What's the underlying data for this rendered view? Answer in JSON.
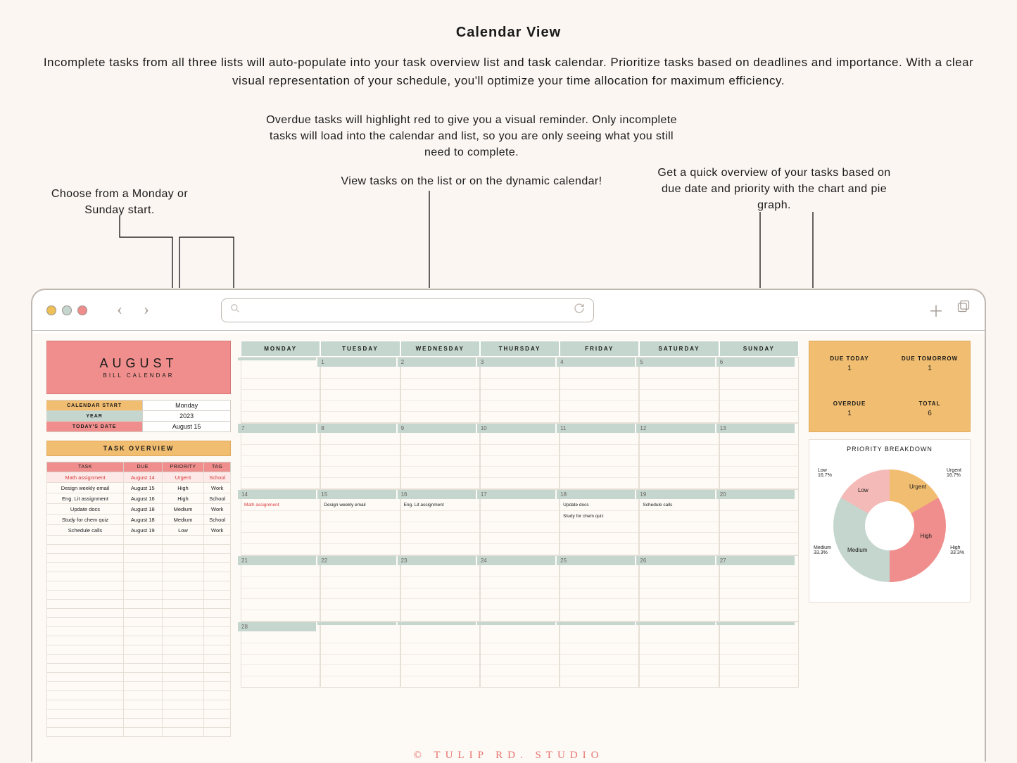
{
  "header": {
    "title": "Calendar View",
    "description": "Incomplete tasks from all three lists will auto-populate into your task overview list and task calendar. Prioritize tasks based on deadlines and importance. With a clear visual representation of your schedule, you'll optimize your time allocation for maximum efficiency."
  },
  "callouts": {
    "left": "Choose from a Monday or Sunday start.",
    "center1": "Overdue tasks will highlight red to give you a visual reminder. Only incomplete tasks will load into the calendar and list, so you are only seeing what you still need to complete.",
    "center2": "View tasks on the list or on the dynamic calendar!",
    "right": "Get a quick overview of your tasks based on due date and priority with the chart and pie graph."
  },
  "month": {
    "name": "AUGUST",
    "subtitle": "BILL CALENDAR"
  },
  "settings": {
    "calendar_start_label": "CALENDAR START",
    "calendar_start_value": "Monday",
    "year_label": "YEAR",
    "year_value": "2023",
    "today_label": "TODAY'S DATE",
    "today_value": "August 15"
  },
  "task_overview": {
    "title": "TASK OVERVIEW",
    "headers": {
      "task": "TASK",
      "due": "DUE",
      "priority": "PRIORITY",
      "tag": "TAG"
    },
    "rows": [
      {
        "task": "Math assignment",
        "due": "August 14",
        "priority": "Urgent",
        "tag": "School",
        "overdue": true
      },
      {
        "task": "Design weekly email",
        "due": "August 15",
        "priority": "High",
        "tag": "Work",
        "overdue": false
      },
      {
        "task": "Eng. Lit assignment",
        "due": "August 16",
        "priority": "High",
        "tag": "School",
        "overdue": false
      },
      {
        "task": "Update docs",
        "due": "August 18",
        "priority": "Medium",
        "tag": "Work",
        "overdue": false
      },
      {
        "task": "Study for chem quiz",
        "due": "August 18",
        "priority": "Medium",
        "tag": "School",
        "overdue": false
      },
      {
        "task": "Schedule calls",
        "due": "August 19",
        "priority": "Low",
        "tag": "Work",
        "overdue": false
      }
    ]
  },
  "calendar": {
    "days": [
      "MONDAY",
      "TUESDAY",
      "WEDNESDAY",
      "THURSDAY",
      "FRIDAY",
      "SATURDAY",
      "SUNDAY"
    ],
    "weeks": [
      [
        {
          "n": "",
          "t": []
        },
        {
          "n": "1",
          "t": []
        },
        {
          "n": "2",
          "t": []
        },
        {
          "n": "3",
          "t": []
        },
        {
          "n": "4",
          "t": []
        },
        {
          "n": "5",
          "t": []
        },
        {
          "n": "6",
          "t": []
        }
      ],
      [
        {
          "n": "7",
          "t": []
        },
        {
          "n": "8",
          "t": []
        },
        {
          "n": "9",
          "t": []
        },
        {
          "n": "10",
          "t": []
        },
        {
          "n": "11",
          "t": []
        },
        {
          "n": "12",
          "t": []
        },
        {
          "n": "13",
          "t": []
        }
      ],
      [
        {
          "n": "14",
          "t": [
            {
              "txt": "Math assignment",
              "red": true
            }
          ]
        },
        {
          "n": "15",
          "t": [
            {
              "txt": "Design weekly email"
            }
          ]
        },
        {
          "n": "16",
          "t": [
            {
              "txt": "Eng. Lit assignment"
            }
          ]
        },
        {
          "n": "17",
          "t": []
        },
        {
          "n": "18",
          "t": [
            {
              "txt": "Update docs"
            },
            {
              "txt": "Study for chem quiz"
            }
          ]
        },
        {
          "n": "19",
          "t": [
            {
              "txt": "Schedule calls"
            }
          ]
        },
        {
          "n": "20",
          "t": []
        }
      ],
      [
        {
          "n": "21",
          "t": []
        },
        {
          "n": "22",
          "t": []
        },
        {
          "n": "23",
          "t": []
        },
        {
          "n": "24",
          "t": []
        },
        {
          "n": "25",
          "t": []
        },
        {
          "n": "26",
          "t": []
        },
        {
          "n": "27",
          "t": []
        }
      ],
      [
        {
          "n": "28",
          "t": []
        },
        {
          "n": "",
          "t": []
        },
        {
          "n": "",
          "t": []
        },
        {
          "n": "",
          "t": []
        },
        {
          "n": "",
          "t": []
        },
        {
          "n": "",
          "t": []
        },
        {
          "n": "",
          "t": []
        }
      ]
    ]
  },
  "stats": {
    "due_today_label": "DUE TODAY",
    "due_today_value": "1",
    "due_tomorrow_label": "DUE TOMORROW",
    "due_tomorrow_value": "1",
    "overdue_label": "OVERDUE",
    "overdue_value": "1",
    "total_label": "TOTAL",
    "total_value": "6"
  },
  "chart_data": {
    "type": "pie",
    "title": "PRIORITY BREAKDOWN",
    "series": [
      {
        "name": "Urgent",
        "value": 16.7
      },
      {
        "name": "High",
        "value": 33.3
      },
      {
        "name": "Medium",
        "value": 33.3
      },
      {
        "name": "Low",
        "value": 16.7
      }
    ],
    "label_urgent": "Urgent",
    "pct_urgent": "16.7%",
    "label_high": "High",
    "pct_high": "33.3%",
    "label_medium": "Medium",
    "pct_medium": "33.3%",
    "label_low": "Low",
    "pct_low": "16.7%"
  },
  "watermark": "© TULIP RD. STUDIO"
}
